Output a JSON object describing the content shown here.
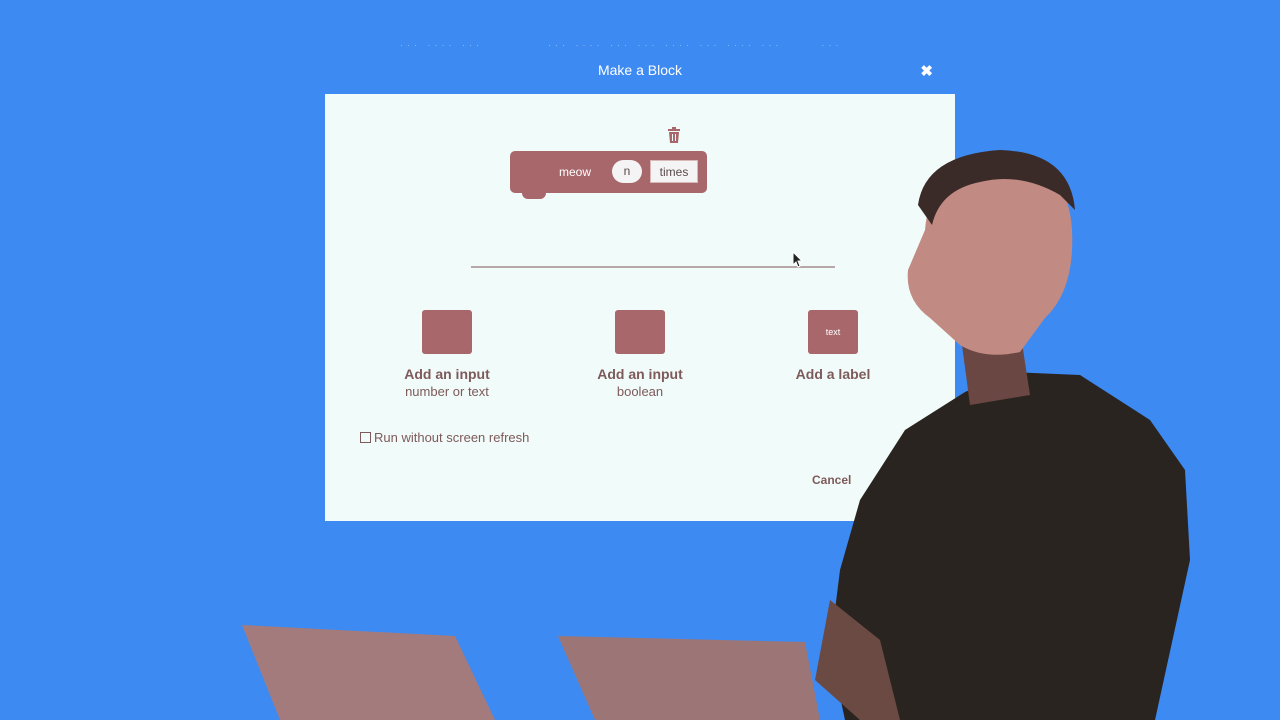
{
  "dialog": {
    "title": "Make a Block",
    "close_symbol": "✖",
    "block_label": "meow",
    "block_arg": "n",
    "block_input_value": "times",
    "options": [
      {
        "swatch_text": "",
        "title": "Add an input",
        "subtitle": "number or text"
      },
      {
        "swatch_text": "",
        "title": "Add an input",
        "subtitle": "boolean"
      },
      {
        "swatch_text": "text",
        "title": "Add a label",
        "subtitle": ""
      }
    ],
    "run_without_refresh_label": "Run without screen refresh",
    "cancel_label": "Cancel"
  },
  "colors": {
    "background": "#3d8af2",
    "dialog_body": "#f1fbf9",
    "block": "#a8676b",
    "text": "#7e5a5b"
  },
  "icons": [
    "trash-icon",
    "close-icon",
    "mouse-cursor-icon"
  ]
}
